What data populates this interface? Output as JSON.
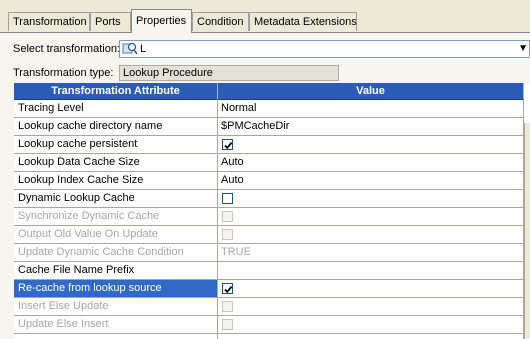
{
  "tabs": [
    {
      "label": "Transformation"
    },
    {
      "label": "Ports"
    },
    {
      "label": "Properties"
    },
    {
      "label": "Condition"
    },
    {
      "label": "Metadata Extensions"
    }
  ],
  "select_transformation": {
    "label": "Select transformation:",
    "value": "L"
  },
  "transformation_type": {
    "label": "Transformation type:",
    "value": "Lookup Procedure"
  },
  "grid": {
    "headers": [
      "Transformation Attribute",
      "Value"
    ],
    "rows": [
      {
        "attribute": "Tracing Level",
        "value": "Normal",
        "kind": "text",
        "enabled": true
      },
      {
        "attribute": "Lookup cache directory name",
        "value": "$PMCacheDir",
        "kind": "text",
        "enabled": true
      },
      {
        "attribute": "Lookup cache persistent",
        "value": "",
        "kind": "checkbox",
        "checked": true,
        "enabled": true
      },
      {
        "attribute": "Lookup Data Cache Size",
        "value": "Auto",
        "kind": "text",
        "enabled": true
      },
      {
        "attribute": "Lookup Index Cache Size",
        "value": "Auto",
        "kind": "text",
        "enabled": true
      },
      {
        "attribute": "Dynamic Lookup Cache",
        "value": "",
        "kind": "checkbox",
        "checked": false,
        "enabled": true
      },
      {
        "attribute": "Synchronize Dynamic Cache",
        "value": "",
        "kind": "checkbox",
        "checked": false,
        "enabled": false
      },
      {
        "attribute": "Output Old Value On Update",
        "value": "",
        "kind": "checkbox",
        "checked": false,
        "enabled": false
      },
      {
        "attribute": "Update Dynamic Cache Condition",
        "value": "TRUE",
        "kind": "text",
        "enabled": false
      },
      {
        "attribute": "Cache File Name Prefix",
        "value": "",
        "kind": "text",
        "enabled": true
      },
      {
        "attribute": "Re-cache from lookup source",
        "value": "",
        "kind": "checkbox",
        "checked": true,
        "enabled": true,
        "selected": true
      },
      {
        "attribute": "Insert Else Update",
        "value": "",
        "kind": "checkbox",
        "checked": false,
        "enabled": false
      },
      {
        "attribute": "Update Else Insert",
        "value": "",
        "kind": "checkbox",
        "checked": false,
        "enabled": false
      },
      {
        "attribute": "",
        "value": "",
        "kind": "text",
        "enabled": false
      }
    ]
  },
  "colors": {
    "selection": "#3169c6",
    "header": "#2b5db8",
    "disabled_text": "#a7a6aa"
  }
}
